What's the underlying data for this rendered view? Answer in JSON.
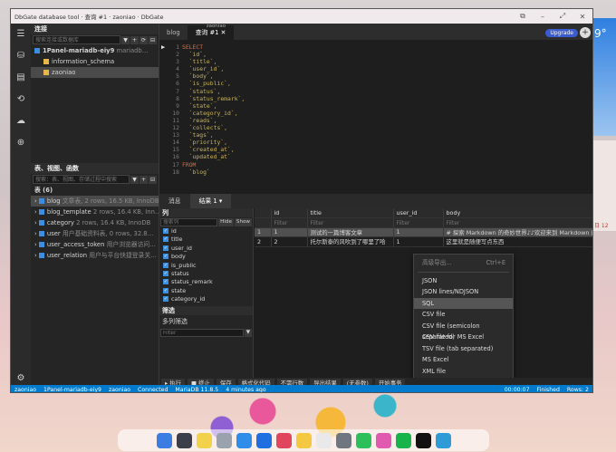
{
  "window": {
    "title": "DbGate database tool · 查询 #1 · zaoniao · DbGate"
  },
  "sidebar": {
    "connections_title": "连接",
    "search_placeholder": "搜索连接或数据库",
    "tree": [
      {
        "label": "1Panel-mariadb-eiy9",
        "extra": "mariadb…"
      },
      {
        "label": "information_schema"
      },
      {
        "label": "zaoniao"
      }
    ],
    "tables_title": "表、视图、函数",
    "tables_search_placeholder": "搜索：表、视图、存储过程中搜索",
    "tables_header": "表 (6)",
    "tables": [
      {
        "name": "blog",
        "info": "文章表, 2 rows, 16.5 KB, InnoDB"
      },
      {
        "name": "blog_template",
        "info": "2 rows, 16.4 KB, Inn…"
      },
      {
        "name": "category",
        "info": "2 rows, 16.4 KB, InnoDB"
      },
      {
        "name": "user",
        "info": "用户基础资料表, 0 rows, 32.8…"
      },
      {
        "name": "user_access_token",
        "info": "用户浏览器访问…"
      },
      {
        "name": "user_relation",
        "info": "用户与平台快捷登录关…"
      }
    ]
  },
  "editor": {
    "tabs": [
      {
        "label": "blog"
      },
      {
        "label": "查询 #1",
        "caption": "zaoniao"
      }
    ],
    "upgrade": "Upgrade",
    "lines": [
      {
        "n": "1",
        "t": "SELECT"
      },
      {
        "n": "2",
        "t": "  `id`,"
      },
      {
        "n": "3",
        "t": "  `title`,"
      },
      {
        "n": "4",
        "t": "  `user_id`,"
      },
      {
        "n": "5",
        "t": "  `body`,"
      },
      {
        "n": "6",
        "t": "  `is_public`,"
      },
      {
        "n": "7",
        "t": "  `status`,"
      },
      {
        "n": "8",
        "t": "  `status_remark`,"
      },
      {
        "n": "9",
        "t": "  `state`,"
      },
      {
        "n": "10",
        "t": "  `category_id`,"
      },
      {
        "n": "11",
        "t": "  `reads`,"
      },
      {
        "n": "12",
        "t": "  `collects`,"
      },
      {
        "n": "13",
        "t": "  `tags`,"
      },
      {
        "n": "14",
        "t": "  `priority`,"
      },
      {
        "n": "15",
        "t": "  `created_at`,"
      },
      {
        "n": "16",
        "t": "  `updated_at`"
      },
      {
        "n": "17",
        "t": "FROM"
      },
      {
        "n": "18",
        "t": "  `blog`"
      }
    ]
  },
  "results": {
    "tabs": [
      "消息",
      "结果 1"
    ],
    "columns_title": "列",
    "columns_search_placeholder": "搜索列",
    "hide": "Hide",
    "show": "Show",
    "columns": [
      "id",
      "title",
      "user_id",
      "body",
      "is_public",
      "status",
      "status_remark",
      "state",
      "category_id"
    ],
    "filter_title": "筛选",
    "multi_filter": "多列筛选",
    "filter_placeholder": "Filter",
    "grid_headers": [
      "id",
      "title",
      "user_id",
      "body"
    ],
    "rows": [
      {
        "n": "1",
        "id": "1",
        "title": "测试的一篇博客文章",
        "user_id": "1",
        "body": "# 探索 Markdown 的奇妙世界♪♪欢迎来到 Markdown 的"
      },
      {
        "n": "2",
        "id": "2",
        "title": "托尔斯泰的风吹到了哪里了哈",
        "user_id": "1",
        "body": "这里就是随便写点东西"
      }
    ]
  },
  "context_menu": {
    "items": [
      {
        "label": "高级导出...",
        "shortcut": "Ctrl+E",
        "disabled": true
      },
      {
        "label": "JSON"
      },
      {
        "label": "JSON lines/NDJSON"
      },
      {
        "label": "SQL",
        "highlight": true
      },
      {
        "label": "CSV file"
      },
      {
        "label": "CSV file (semicolon separated)"
      },
      {
        "label": "CSV file for MS Excel"
      },
      {
        "label": "TSV file (tab separated)"
      },
      {
        "label": "MS Excel"
      },
      {
        "label": "XML file"
      }
    ]
  },
  "toolbar": {
    "execute": "▸ 执行",
    "stop": "■ 终止",
    "save": "保存",
    "format": "格式化代码",
    "not_exec": "不需行数",
    "export": "导出结果",
    "params": "(无参数)",
    "begin_tx": "开始事务"
  },
  "status": {
    "db": "zaoniao",
    "conn": "1Panel-mariadb-eiy9",
    "db2": "zaoniao",
    "connected": "Connected",
    "version": "MariaDB 11.8.5",
    "ago": "4 minutes ago",
    "time": "00:00:07",
    "finished": "Finished",
    "rows": "Rows: 2"
  },
  "desktop_right": {
    "temp": "9°",
    "date": "日 12"
  }
}
